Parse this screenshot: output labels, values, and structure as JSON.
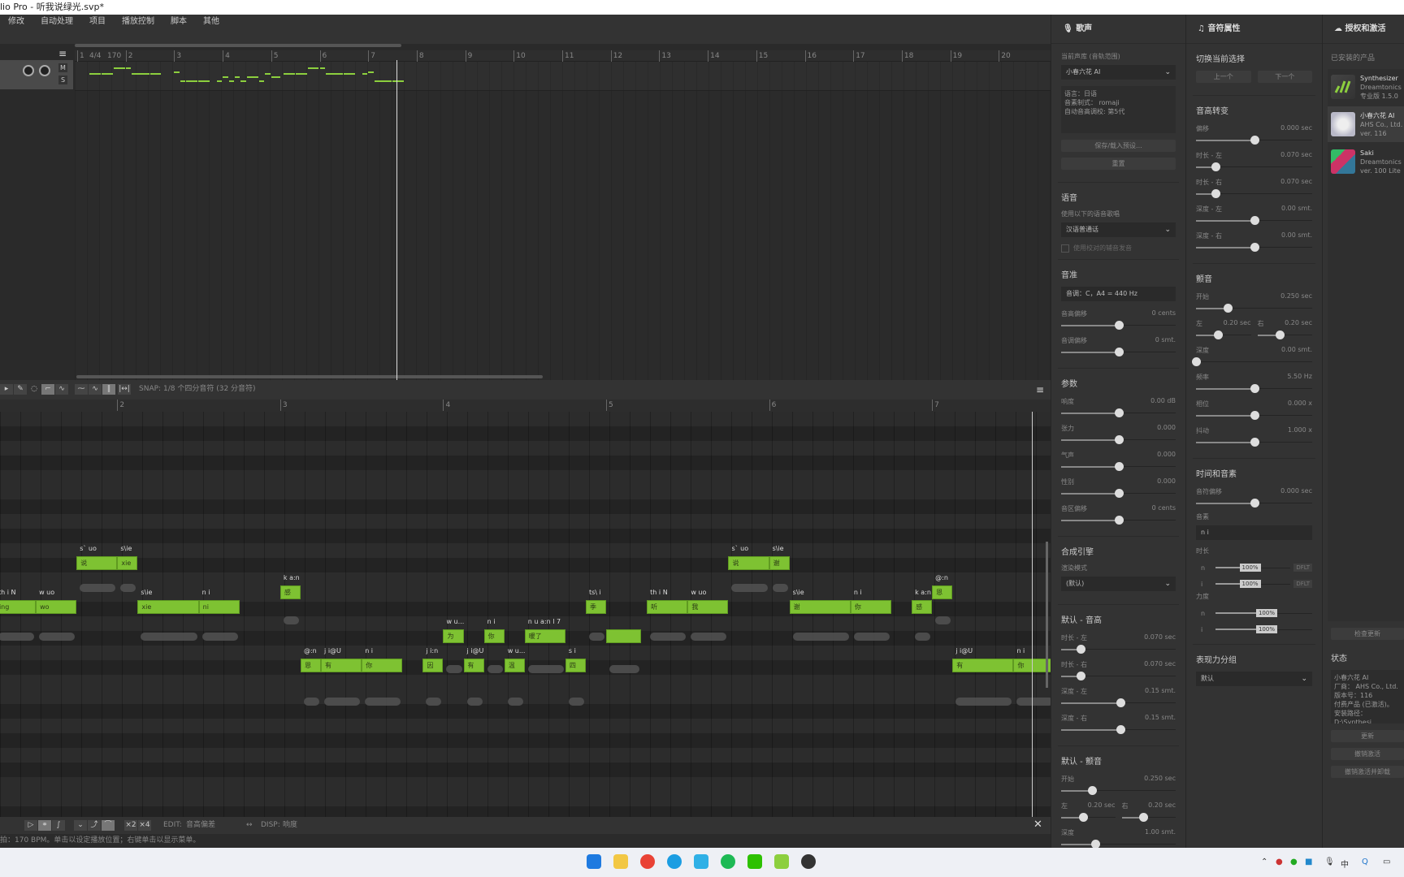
{
  "window": {
    "title": "lio Pro - 听我说绿光.svp*"
  },
  "menu": [
    "修改",
    "自动处理",
    "项目",
    "播放控制",
    "脚本",
    "其他"
  ],
  "arrangement": {
    "ruler": {
      "time_signature": "4/4",
      "tempo": "170",
      "measures": [
        "1",
        "2",
        "3",
        "4",
        "5",
        "6",
        "7",
        "8",
        "9",
        "10",
        "11",
        "12",
        "13",
        "14",
        "15",
        "16",
        "17",
        "18",
        "19",
        "20"
      ]
    },
    "track": {
      "mute": "M",
      "solo": "S"
    }
  },
  "piano_roll": {
    "snap_label": "SNAP:",
    "snap_value": "1/8 个四分音符 (32 分音符)",
    "ruler_measures": [
      "2",
      "3",
      "4",
      "5",
      "6",
      "7"
    ],
    "note_color": "#7ec232",
    "notes": [
      {
        "lyric": "ing",
        "phoneme": "th i N",
        "start": 1.0,
        "dur": 1.0,
        "pitch": 64
      },
      {
        "lyric": "wo",
        "phoneme": "w uo",
        "start": 2.0,
        "dur": 1.0,
        "pitch": 64
      },
      {
        "lyric": "说",
        "phoneme": "s` uo",
        "start": 3.0,
        "dur": 1.0,
        "pitch": 67
      },
      {
        "lyric": "xie",
        "phoneme": "s\\ie",
        "start": 4.0,
        "dur": 0.5,
        "pitch": 67
      },
      {
        "lyric": "xie",
        "phoneme": "s\\ie",
        "start": 4.5,
        "dur": 1.5,
        "pitch": 64
      },
      {
        "lyric": "ni",
        "phoneme": "n i",
        "start": 6.0,
        "dur": 1.0,
        "pitch": 64
      },
      {
        "lyric": "感",
        "phoneme": "k a:n",
        "start": 8.0,
        "dur": 0.5,
        "pitch": 65
      },
      {
        "lyric": "恩",
        "phoneme": "@:n",
        "start": 8.5,
        "dur": 0.5,
        "pitch": 60
      },
      {
        "lyric": "有",
        "phoneme": "j i@U",
        "start": 9.0,
        "dur": 1.0,
        "pitch": 60
      },
      {
        "lyric": "你",
        "phoneme": "n i",
        "start": 10.0,
        "dur": 1.0,
        "pitch": 60
      },
      {
        "lyric": "因",
        "phoneme": "j i:n",
        "start": 11.5,
        "dur": 0.5,
        "pitch": 60
      },
      {
        "lyric": "为",
        "phoneme": "w u...",
        "start": 12.0,
        "dur": 0.5,
        "pitch": 62
      },
      {
        "lyric": "有",
        "phoneme": "j i@U",
        "start": 12.5,
        "dur": 0.5,
        "pitch": 60
      },
      {
        "lyric": "你",
        "phoneme": "n i",
        "start": 13.0,
        "dur": 0.5,
        "pitch": 62
      },
      {
        "lyric": "温",
        "phoneme": "w u...",
        "start": 13.5,
        "dur": 0.5,
        "pitch": 60
      },
      {
        "lyric": "暖了",
        "phoneme": "n u a:n l 7",
        "start": 14.0,
        "dur": 1.0,
        "pitch": 62
      },
      {
        "lyric": "四",
        "phoneme": "s i",
        "start": 15.0,
        "dur": 0.5,
        "pitch": 60
      },
      {
        "lyric": "季",
        "phoneme": "ts\\ i",
        "start": 15.5,
        "dur": 0.5,
        "pitch": 64
      },
      {
        "lyric": "",
        "phoneme": "",
        "start": 16.0,
        "dur": 0.85,
        "pitch": 62
      },
      {
        "lyric": "听",
        "phoneme": "th i N",
        "start": 17.0,
        "dur": 1.0,
        "pitch": 64
      },
      {
        "lyric": "我",
        "phoneme": "w uo",
        "start": 18.0,
        "dur": 1.0,
        "pitch": 64
      },
      {
        "lyric": "说",
        "phoneme": "s` uo",
        "start": 19.0,
        "dur": 1.0,
        "pitch": 67
      },
      {
        "lyric": "谢",
        "phoneme": "s\\ie",
        "start": 20.0,
        "dur": 0.5,
        "pitch": 67
      },
      {
        "lyric": "谢",
        "phoneme": "s\\ie",
        "start": 20.5,
        "dur": 1.5,
        "pitch": 64
      },
      {
        "lyric": "你",
        "phoneme": "n i",
        "start": 22.0,
        "dur": 1.0,
        "pitch": 64
      },
      {
        "lyric": "感",
        "phoneme": "k a:n",
        "start": 23.5,
        "dur": 0.5,
        "pitch": 64
      },
      {
        "lyric": "恩",
        "phoneme": "@:n",
        "start": 24.0,
        "dur": 0.5,
        "pitch": 65
      },
      {
        "lyric": "有",
        "phoneme": "j i@U",
        "start": 24.5,
        "dur": 1.5,
        "pitch": 60
      },
      {
        "lyric": "你",
        "phoneme": "n i",
        "start": 26.0,
        "dur": 1.0,
        "pitch": 60
      }
    ],
    "edit_label": "EDIT:",
    "edit_value": "音高偏差",
    "disp_label": "DISP:",
    "disp_value": "响度",
    "x2": "×2",
    "x4": "×4"
  },
  "status": "拍：170 BPM。单击以设定播放位置；右键单击以显示菜单。",
  "voice_panel": {
    "title": "歌声",
    "voicebank_label": "当前声库 (音轨范围)",
    "voicebank": "小春六花 AI",
    "info": [
      "语言：日语",
      "音素制式： romaji",
      "自动音高调校: 第5代"
    ],
    "preset_button": "保存/载入预设...",
    "reset_button": "重置",
    "language_title": "语音",
    "language_label": "使用以下的语音歌唱",
    "language": "汉语普通话",
    "checkbox_label": "使用校对的辅音发音",
    "tuning_title": "音准",
    "tuning_field": "音调：C，A4 = 440 Hz",
    "tuning_sliders": [
      {
        "label": "音高偏移",
        "value": "0 cents",
        "pos": 0.5
      },
      {
        "label": "音调偏移",
        "value": "0 smt.",
        "pos": 0.5
      }
    ],
    "params_title": "参数",
    "params": [
      {
        "label": "响度",
        "value": "0.00 dB",
        "pos": 0.5
      },
      {
        "label": "张力",
        "value": "0.000",
        "pos": 0.5
      },
      {
        "label": "气声",
        "value": "0.000",
        "pos": 0.5
      },
      {
        "label": "性别",
        "value": "0.000",
        "pos": 0.5
      },
      {
        "label": "音区偏移",
        "value": "0 cents",
        "pos": 0.5
      }
    ],
    "engine_title": "合成引擎",
    "render_label": "渲染模式",
    "render_mode": "(默认)",
    "pitch_title": "默认 - 音高",
    "pitch": [
      {
        "label": "时长 - 左",
        "value": "0.070 sec",
        "pos": 0.17
      },
      {
        "label": "时长 - 右",
        "value": "0.070 sec",
        "pos": 0.17
      },
      {
        "label": "深度 - 左",
        "value": "0.15 smt.",
        "pos": 0.52
      },
      {
        "label": "深度 - 右",
        "value": "0.15 smt.",
        "pos": 0.52
      }
    ],
    "vibrato_title": "默认 - 颤音",
    "vibrato_start": {
      "label": "开始",
      "value": "0.250 sec",
      "pos": 0.27
    },
    "vibrato_left": {
      "label": "左",
      "value": "0.20 sec",
      "pos": 0.4
    },
    "vibrato_right": {
      "label": "右",
      "value": "0.20 sec",
      "pos": 0.4
    },
    "vibrato_depth": {
      "label": "深度",
      "value": "1.00 smt.",
      "pos": 0.3
    }
  },
  "note_panel": {
    "title": "音符属性",
    "switch_title": "切换当前选择",
    "prev": "上一个",
    "next": "下一个",
    "transition_title": "音高转变",
    "transition": [
      {
        "label": "偏移",
        "value": "0.000 sec",
        "pos": 0.5
      },
      {
        "label": "时长 - 左",
        "value": "0.070 sec",
        "pos": 0.17
      },
      {
        "label": "时长 - 右",
        "value": "0.070 sec",
        "pos": 0.17
      },
      {
        "label": "深度 - 左",
        "value": "0.00 smt.",
        "pos": 0.5
      },
      {
        "label": "深度 - 右",
        "value": "0.00 smt.",
        "pos": 0.5
      }
    ],
    "vibrato_title": "颤音",
    "vibrato_start": {
      "label": "开始",
      "value": "0.250 sec",
      "pos": 0.27
    },
    "vibrato_left": {
      "label": "左",
      "value": "0.20 sec",
      "pos": 0.4
    },
    "vibrato_right": {
      "label": "右",
      "value": "0.20 sec",
      "pos": 0.4
    },
    "vibrato": [
      {
        "label": "深度",
        "value": "0.00 smt.",
        "pos": 0.0
      },
      {
        "label": "频率",
        "value": "5.50 Hz",
        "pos": 0.5
      },
      {
        "label": "相位",
        "value": "0.000 x",
        "pos": 0.5
      },
      {
        "label": "抖动",
        "value": "1.000 x",
        "pos": 0.5
      }
    ],
    "timing_title": "时间和音素",
    "timing": [
      {
        "label": "音符偏移",
        "value": "0.000 sec",
        "pos": 0.5
      }
    ],
    "phoneme_label": "音素",
    "phonemes": "n i",
    "duration_label": "时长",
    "durations": [
      {
        "ph": "n",
        "value": "100%",
        "pos": 0.4,
        "dflt": "DFLT"
      },
      {
        "ph": "i",
        "value": "100%",
        "pos": 0.4,
        "dflt": "DFLT"
      }
    ],
    "strength_label": "力度",
    "strengths": [
      {
        "ph": "n",
        "value": "100%",
        "pos": 0.5
      },
      {
        "ph": "i",
        "value": "100%",
        "pos": 0.5
      }
    ],
    "expr_title": "表现力分组",
    "expr": "默认"
  },
  "license_panel": {
    "title": "授权和激活",
    "installed_label": "已安装的产品",
    "products": [
      {
        "name": "Synthesizer",
        "vendor": "Dreamtonics",
        "version": "专业版 1.5.0",
        "logo": "synthv-logo"
      },
      {
        "name": "小春六花 AI",
        "vendor": "AHS Co., Ltd.",
        "version": "ver. 116",
        "logo": "rikka-avatar"
      },
      {
        "name": "Saki",
        "vendor": "Dreamtonics",
        "version": "ver. 100 Lite",
        "logo": "saki-logo"
      }
    ],
    "check_update": "检查更新",
    "status_title": "状态",
    "status_lines": [
      "小春六花 AI",
      "厂商： AHS Co., Ltd.",
      "版本号：116",
      "付费产品 (已激活)。",
      "安装路径： D:\\Synthesi",
      "Studio\\databases\\Koh"
    ],
    "update": "更新",
    "deactivate": "撤销激活",
    "deactivate_uninstall": "撤销激活并卸载"
  },
  "taskbar": {
    "icons": [
      "windows-start-icon",
      "file-explorer-icon",
      "chrome-icon",
      "edge-icon",
      "edge-beta-icon",
      "spotify-icon",
      "wechat-icon",
      "synthv-icon",
      "obs-icon"
    ]
  }
}
